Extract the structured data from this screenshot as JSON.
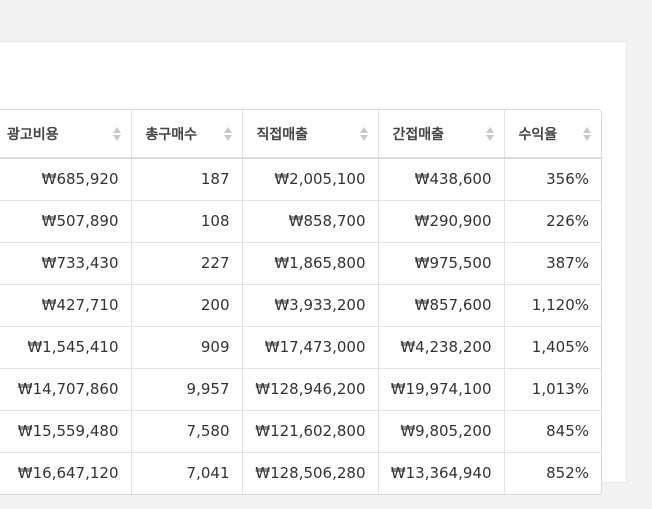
{
  "table": {
    "headers": [
      "광고비용",
      "총구매수",
      "직접매출",
      "간접매출",
      "수익율"
    ],
    "rows": [
      [
        "₩685,920",
        "187",
        "₩2,005,100",
        "₩438,600",
        "356%"
      ],
      [
        "₩507,890",
        "108",
        "₩858,700",
        "₩290,900",
        "226%"
      ],
      [
        "₩733,430",
        "227",
        "₩1,865,800",
        "₩975,500",
        "387%"
      ],
      [
        "₩427,710",
        "200",
        "₩3,933,200",
        "₩857,600",
        "1,120%"
      ],
      [
        "₩1,545,410",
        "909",
        "₩17,473,000",
        "₩4,238,200",
        "1,405%"
      ],
      [
        "₩14,707,860",
        "9,957",
        "₩128,946,200",
        "₩19,974,100",
        "1,013%"
      ],
      [
        "₩15,559,480",
        "7,580",
        "₩121,602,800",
        "₩9,805,200",
        "845%"
      ],
      [
        "₩16,647,120",
        "7,041",
        "₩128,506,280",
        "₩13,364,940",
        "852%"
      ]
    ]
  },
  "icons": {
    "sort": "sort-up-down-icon"
  },
  "colors": {
    "page_background": "#f3f3f3",
    "panel_background": "#ffffff",
    "border": "#d9d9d9",
    "sort_arrow": "#c9c9c9",
    "text": "#333333"
  }
}
